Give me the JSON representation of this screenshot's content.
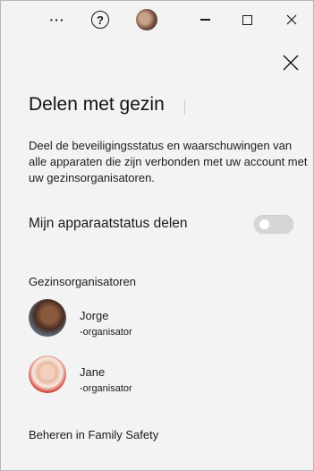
{
  "titlebar": {
    "more_icon": "more-icon",
    "help_icon": "help-icon",
    "help_glyph": "?",
    "more_glyph": "···"
  },
  "panel": {
    "title": "Delen met gezin",
    "description": "Deel de beveiligingsstatus en waarschuwingen van alle apparaten die zijn verbonden met uw account met uw gezinsorganisatoren.",
    "share_toggle": {
      "label": "Mijn apparaatstatus delen",
      "state": "off"
    },
    "organizers_heading": "Gezinsorganisatoren",
    "organizers": [
      {
        "name": "Jorge",
        "role": "-organisator"
      },
      {
        "name": "Jane",
        "role": "-organisator"
      }
    ],
    "manage_link": "Beheren in Family Safety"
  }
}
